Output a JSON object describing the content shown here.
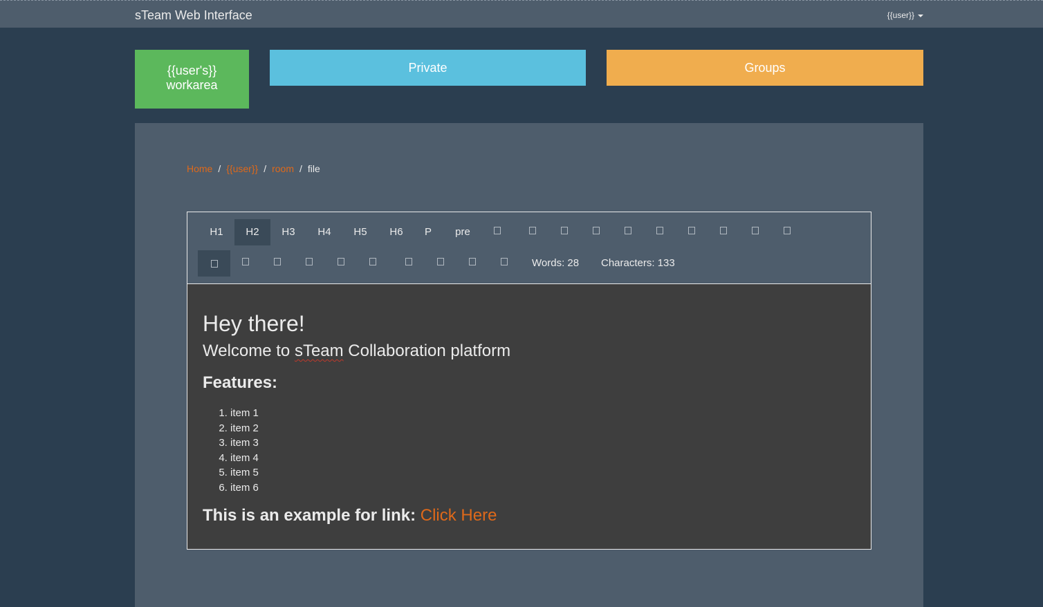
{
  "header": {
    "brand": "sTeam Web Interface",
    "user_menu": "{{user}}"
  },
  "tiles": {
    "workarea_line1": "{{user's}}",
    "workarea_line2": "workarea",
    "private": "Private",
    "groups": "Groups",
    "colors": {
      "workarea": "#5cb85c",
      "private": "#5bc0de",
      "groups": "#f0ad4e"
    }
  },
  "breadcrumb": {
    "home": "Home",
    "user": "{{user}}",
    "room": "room",
    "current": "file"
  },
  "toolbar": {
    "row1_labels": [
      "H1",
      "H2",
      "H3",
      "H4",
      "H5",
      "H6",
      "P",
      "pre"
    ],
    "words": "Words: 28",
    "characters": "Characters: 133"
  },
  "document": {
    "heading1": "Hey there!",
    "heading2_before": "Welcome to ",
    "heading2_misspelled": "sTeam",
    "heading2_after": " Collaboration platform",
    "heading3": "Features:",
    "items": [
      "item 1",
      "item 2",
      "item 3",
      "item 4",
      "item 5",
      "item 6"
    ],
    "link_prefix": "This is an example for link: ",
    "link_text": "Click Here"
  },
  "colors": {
    "accent": "#df691a",
    "background": "#2b3e50",
    "panel": "#4e5d6c"
  }
}
